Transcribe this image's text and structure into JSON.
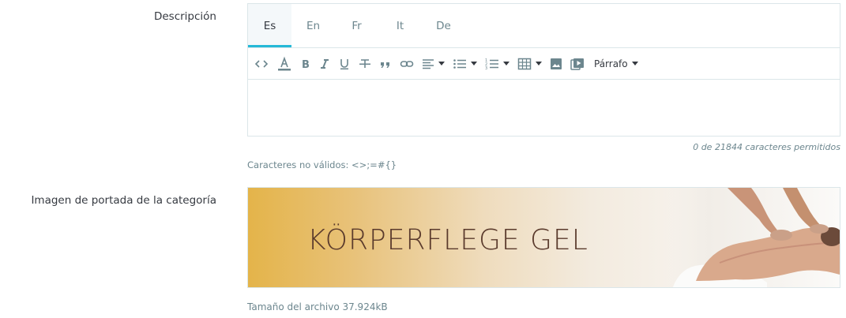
{
  "fields": {
    "description_label": "Descripción",
    "cover_label": "Imagen de portada de la categoría"
  },
  "editor": {
    "tabs": [
      {
        "label": "Es",
        "active": true
      },
      {
        "label": "En",
        "active": false
      },
      {
        "label": "Fr",
        "active": false
      },
      {
        "label": "It",
        "active": false
      },
      {
        "label": "De",
        "active": false
      }
    ],
    "toolbar": {
      "icons": [
        "code-icon",
        "text-color-icon",
        "bold-icon",
        "italic-icon",
        "underline-icon",
        "strikethrough-icon",
        "blockquote-icon",
        "link-icon",
        "align-icon",
        "bullet-list-icon",
        "numbered-list-icon",
        "table-icon",
        "image-icon",
        "media-icon"
      ],
      "format_label": "Párrafo"
    },
    "counter": "0 de 21844 caracteres permitidos"
  },
  "invalid_chars": "Caracteres no válidos: <>;=#{}",
  "cover": {
    "image_text": "KÖRPERFLEGE GEL",
    "file_size": "Tamaño del archivo 37.924kB"
  },
  "colors": {
    "accent": "#25b9d7",
    "muted_text": "#6c868e",
    "border": "#dbe6e9"
  }
}
